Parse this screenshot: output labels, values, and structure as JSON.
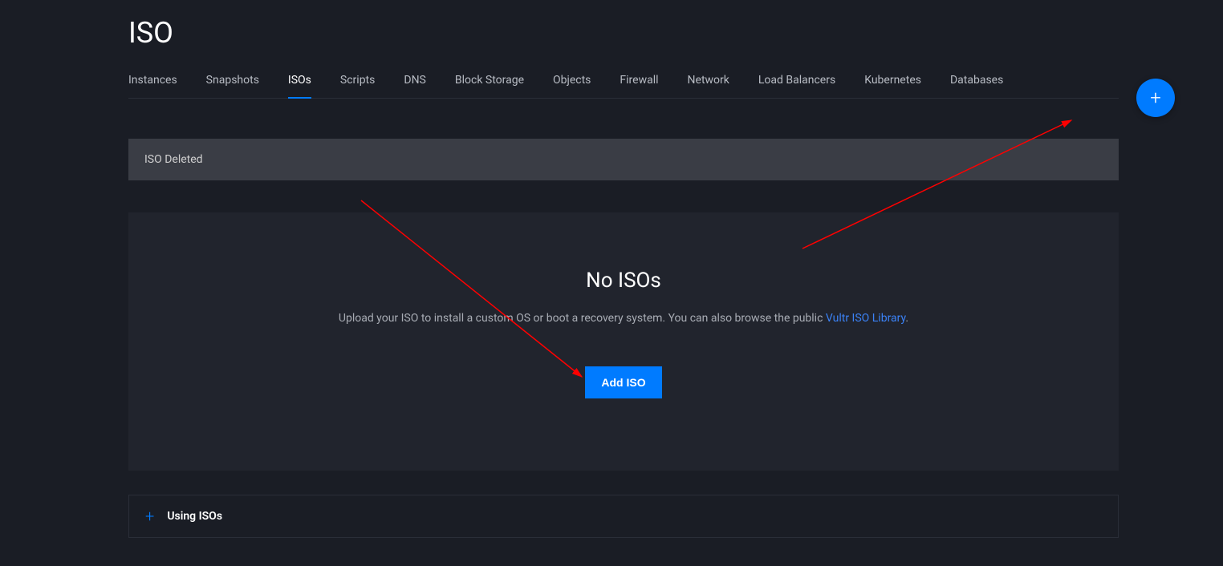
{
  "page": {
    "title": "ISO"
  },
  "tabs": [
    {
      "label": "Instances",
      "active": false
    },
    {
      "label": "Snapshots",
      "active": false
    },
    {
      "label": "ISOs",
      "active": true
    },
    {
      "label": "Scripts",
      "active": false
    },
    {
      "label": "DNS",
      "active": false
    },
    {
      "label": "Block Storage",
      "active": false
    },
    {
      "label": "Objects",
      "active": false
    },
    {
      "label": "Firewall",
      "active": false
    },
    {
      "label": "Network",
      "active": false
    },
    {
      "label": "Load Balancers",
      "active": false
    },
    {
      "label": "Kubernetes",
      "active": false
    },
    {
      "label": "Databases",
      "active": false
    }
  ],
  "notification": {
    "message": "ISO Deleted"
  },
  "empty": {
    "heading": "No ISOs",
    "text_prefix": "Upload your ISO to install a custom OS or boot a recovery system. You can also browse the public ",
    "link_text": "Vultr ISO Library",
    "text_suffix": ".",
    "button_label": "Add ISO"
  },
  "accordion": {
    "title": "Using ISOs"
  },
  "fab": {
    "icon_glyph": "+"
  }
}
